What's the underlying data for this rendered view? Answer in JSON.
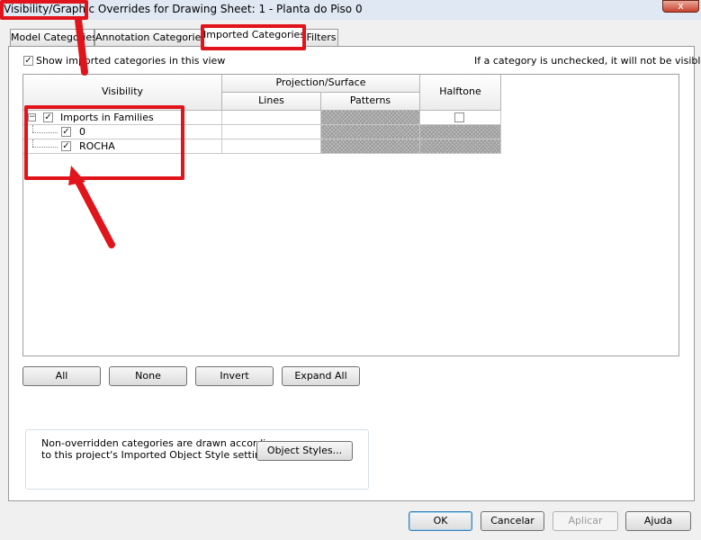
{
  "window": {
    "title": "Visibility/Graphic Overrides for Drawing Sheet: 1 - Planta do Piso 0",
    "close_glyph": "x"
  },
  "tabs": [
    {
      "label": "Model Categories"
    },
    {
      "label": "Annotation Categories"
    },
    {
      "label": "Imported Categories"
    },
    {
      "label": "Filters"
    }
  ],
  "show_toggle": {
    "label": "Show imported categories in this view",
    "checked": "✓"
  },
  "hint": "If a category is unchecked, it will not be visible.",
  "grid": {
    "headers": {
      "visibility": "Visibility",
      "projection": "Projection/Surface",
      "lines": "Lines",
      "patterns": "Patterns",
      "halftone": "Halftone"
    },
    "rows": [
      {
        "label": "Imports in Families",
        "checked": "✓",
        "expander": "−"
      },
      {
        "label": "0",
        "checked": "✓"
      },
      {
        "label": "ROCHA",
        "checked": "✓"
      }
    ]
  },
  "buttons": {
    "all": "All",
    "none": "None",
    "invert": "Invert",
    "expand_all": "Expand All"
  },
  "note": {
    "line1": "Non-overridden categories are drawn according",
    "line2": "to this project's Imported Object Style settings.",
    "object_styles": "Object Styles..."
  },
  "footer": {
    "ok": "OK",
    "cancel": "Cancelar",
    "apply": "Aplicar",
    "help": "Ajuda"
  },
  "colors": {
    "annotation_red": "#e0141a"
  }
}
